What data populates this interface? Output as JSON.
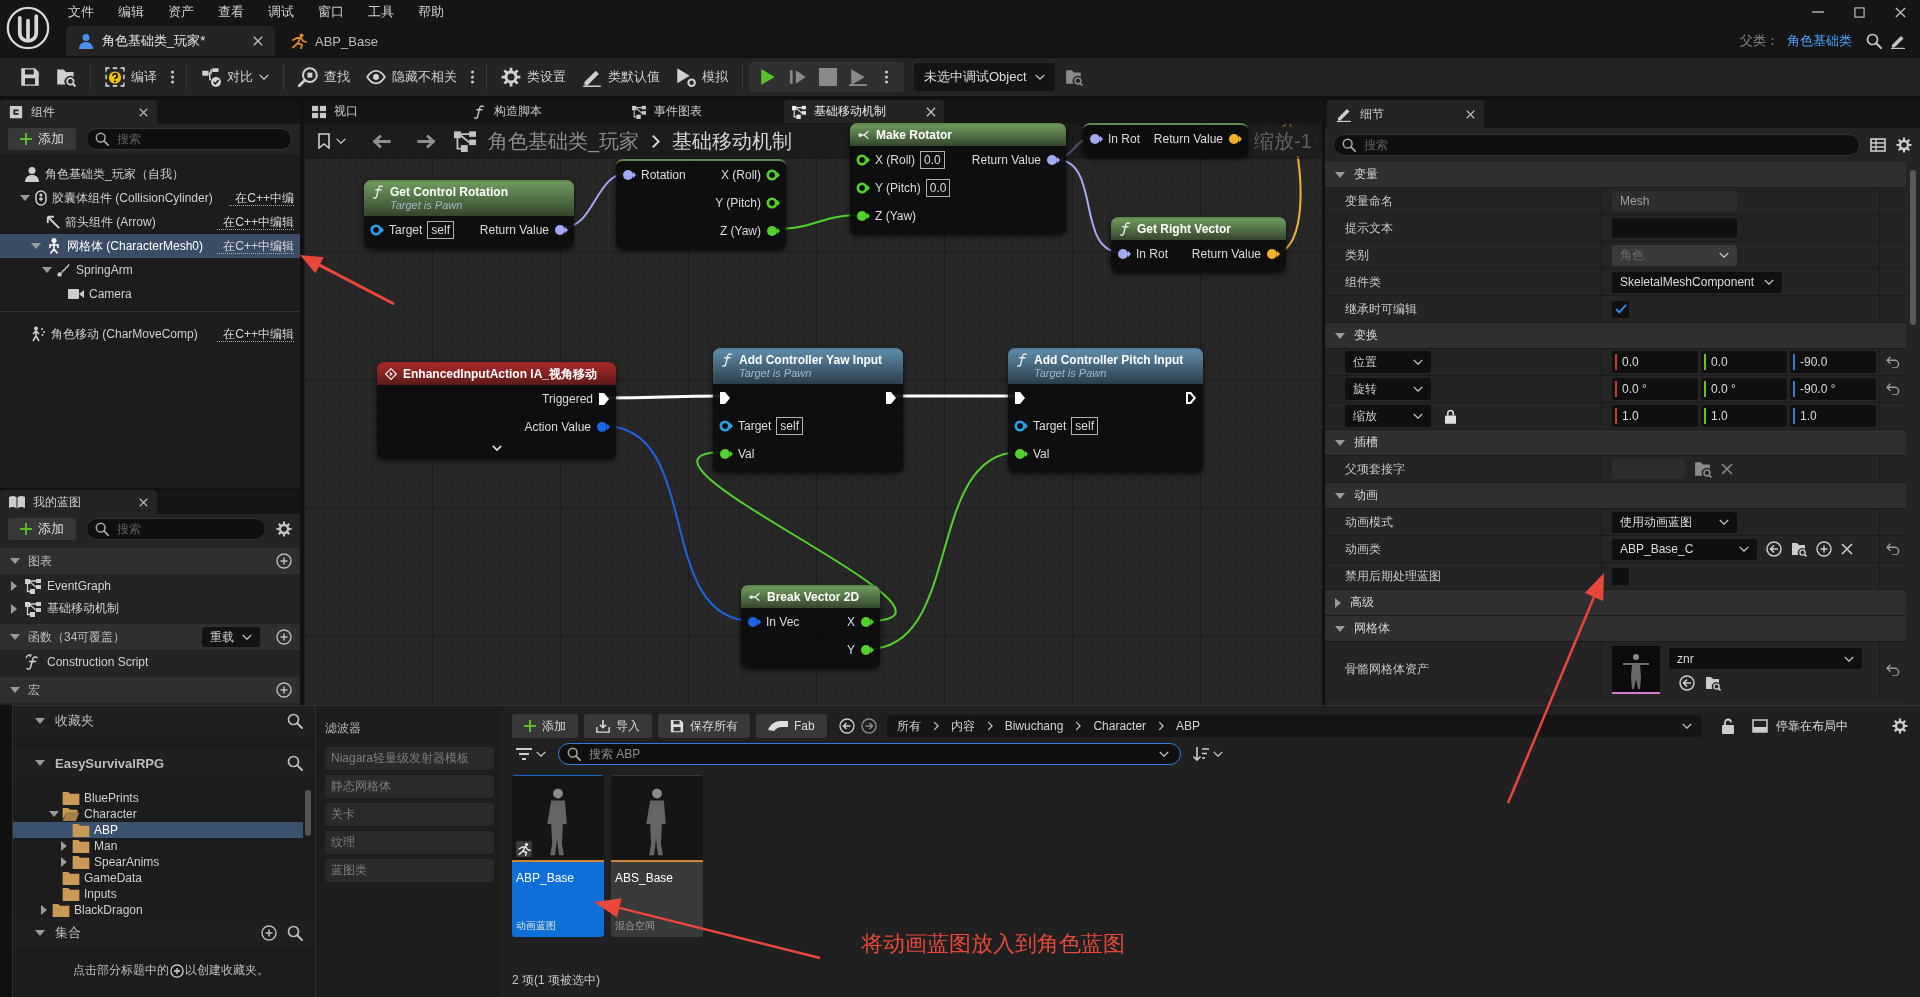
{
  "menu_bar": {
    "items": [
      "文件",
      "编辑",
      "资产",
      "查看",
      "调试",
      "窗口",
      "工具",
      "帮助"
    ]
  },
  "document_tabs": [
    {
      "label": "角色基础类_玩家*",
      "kind": "blueprint",
      "selected": true
    },
    {
      "label": "ABP_Base",
      "kind": "anim_blueprint",
      "selected": false
    }
  ],
  "parent_class": {
    "label": "父类：",
    "value": "角色基础类"
  },
  "toolbar": {
    "groups": [
      [
        {
          "kind": "save"
        },
        {
          "kind": "browse"
        }
      ],
      [
        {
          "kind": "compile",
          "label": "编译",
          "more": true
        }
      ],
      [
        {
          "kind": "diff",
          "label": "对比",
          "caret": true
        }
      ],
      [
        {
          "kind": "find",
          "label": "查找"
        },
        {
          "kind": "hide",
          "label": "隐藏不相关",
          "more": true
        }
      ],
      [
        {
          "kind": "class_settings",
          "label": "类设置"
        },
        {
          "kind": "class_defaults",
          "label": "类默认值"
        },
        {
          "kind": "simulate",
          "label": "模拟"
        }
      ]
    ],
    "play_controls": [
      {
        "kind": "play"
      },
      {
        "kind": "advance"
      },
      {
        "kind": "stop"
      },
      {
        "kind": "eject"
      }
    ],
    "play_more": true,
    "debug_object": "未选中调试Object"
  },
  "components": {
    "title": "组件",
    "add_label": "添加",
    "search_placeholder": "搜索",
    "tree": [
      {
        "label": "角色基础类_玩家（自我）",
        "kind": "actor",
        "selected": false,
        "children": [
          {
            "label": "胶囊体组件 (CollisionCylinder)",
            "kind": "capsule",
            "edit_link": "在C++中编",
            "selected": false,
            "expanded": true,
            "children": [
              {
                "label": "箭头组件 (Arrow)",
                "kind": "arrow",
                "edit_link": "在C++中编辑",
                "selected": false
              },
              {
                "label": "网格体 (CharacterMesh0)",
                "kind": "mesh",
                "edit_link": "在C++中编辑",
                "selected": true,
                "expanded": true,
                "children": [
                  {
                    "label": "SpringArm",
                    "kind": "spring_arm",
                    "selected": false,
                    "expanded": true,
                    "children": [
                      {
                        "label": "Camera",
                        "kind": "camera",
                        "selected": false
                      }
                    ]
                  }
                ]
              }
            ]
          }
        ]
      }
    ],
    "other": [
      {
        "label": "角色移动 (CharMoveComp)",
        "kind": "movement",
        "edit_link": "在C++中编辑",
        "selected": false
      }
    ]
  },
  "my_blueprint": {
    "title": "我的蓝图",
    "add_label": "添加",
    "search_placeholder": "搜索",
    "sections": [
      {
        "title": "图表",
        "expanded": true,
        "items": [
          {
            "label": "EventGraph",
            "kind": "graph",
            "expanded": false
          },
          {
            "label": "基础移动机制",
            "kind": "graph",
            "expanded": false
          }
        ]
      },
      {
        "title": "函数（34可覆盖）",
        "expanded": true,
        "override_label": "重载",
        "items": [
          {
            "label": "Construction Script",
            "kind": "construction"
          }
        ]
      },
      {
        "title": "宏",
        "expanded": true
      }
    ]
  },
  "graph_tabs": [
    {
      "label": "视口",
      "kind": "viewport",
      "selected": false
    },
    {
      "label": "构造脚本",
      "kind": "function",
      "selected": false
    },
    {
      "label": "事件图表",
      "kind": "graph",
      "selected": false
    },
    {
      "label": "基础移动机制",
      "kind": "graph",
      "selected": true
    }
  ],
  "breadcrumb": [
    "角色基础类_玩家",
    "基础移动机制"
  ],
  "zoom_label": "缩放-1",
  "nodes": [
    {
      "kind": "pure_function",
      "title": "Get Control Rotation",
      "subtitle": "Target is Pawn",
      "rows": [
        {
          "in": {
            "label": "Target",
            "kind": "data",
            "color": "#2aa0e8",
            "connected": false,
            "default": "self"
          },
          "out": {
            "label": "Return Value",
            "kind": "data",
            "color": "#a3aaf5",
            "connected": true
          }
        }
      ]
    },
    {
      "kind": "struct",
      "rows": [
        {
          "in": {
            "label": "Rotation",
            "kind": "data",
            "color": "#a3aaf5",
            "connected": true
          },
          "out": {
            "label": "X (Roll)",
            "kind": "data",
            "color": "#52d22a",
            "connected": false
          }
        },
        {
          "out": {
            "label": "Y (Pitch)",
            "kind": "data",
            "color": "#52d22a",
            "connected": false
          }
        },
        {
          "out": {
            "label": "Z (Yaw)",
            "kind": "data",
            "color": "#52d22a",
            "connected": true
          }
        }
      ]
    },
    {
      "kind": "struct",
      "title": "Make Rotator",
      "rows": [
        {
          "in": {
            "label": "X (Roll)",
            "kind": "data",
            "color": "#52d22a",
            "connected": false,
            "default": "0.0"
          },
          "out": {
            "label": "Return Value",
            "kind": "data",
            "color": "#a3aaf5",
            "connected": true
          }
        },
        {
          "in": {
            "label": "Y (Pitch)",
            "kind": "data",
            "color": "#52d22a",
            "connected": false,
            "default": "0.0"
          }
        },
        {
          "in": {
            "label": "Z (Yaw)",
            "kind": "data",
            "color": "#52d22a",
            "connected": true
          }
        }
      ]
    },
    {
      "kind": "pure_function",
      "rows": [
        {
          "in": {
            "label": "In Rot",
            "kind": "data",
            "color": "#a3aaf5",
            "connected": true
          },
          "out": {
            "label": "Return Value",
            "kind": "data",
            "color": "#f3b12e",
            "connected": true
          }
        }
      ]
    },
    {
      "kind": "pure_function",
      "title": "Get Right Vector",
      "rows": [
        {
          "in": {
            "label": "In Rot",
            "kind": "data",
            "color": "#a3aaf5",
            "connected": true
          },
          "out": {
            "label": "Return Value",
            "kind": "data",
            "color": "#f3b12e",
            "connected": true
          }
        }
      ]
    },
    {
      "kind": "event",
      "title": "EnhancedInputAction IA_视角移动",
      "advanced_pins": true,
      "rows": [
        {
          "out": {
            "label": "Triggered",
            "kind": "exec",
            "color": "#ffffff",
            "connected": true
          }
        },
        {
          "out": {
            "label": "Action Value",
            "kind": "data",
            "color": "#1a66e6",
            "connected": true
          }
        }
      ]
    },
    {
      "kind": "function",
      "title": "Add Controller Yaw Input",
      "subtitle": "Target is Pawn",
      "rows": [
        {
          "in": {
            "kind": "exec",
            "color": "#ffffff",
            "connected": true
          },
          "out": {
            "kind": "exec",
            "color": "#ffffff",
            "connected": true
          }
        },
        {
          "in": {
            "label": "Target",
            "kind": "data",
            "color": "#2aa0e8",
            "connected": false,
            "default": "self"
          }
        },
        {
          "in": {
            "label": "Val",
            "kind": "data",
            "color": "#52d22a",
            "connected": true
          }
        }
      ]
    },
    {
      "kind": "function",
      "title": "Add Controller Pitch Input",
      "subtitle": "Target is Pawn",
      "rows": [
        {
          "in": {
            "kind": "exec",
            "color": "#ffffff",
            "connected": true
          },
          "out": {
            "kind": "exec",
            "color": "#ffffff",
            "connected": false
          }
        },
        {
          "in": {
            "label": "Target",
            "kind": "data",
            "color": "#2aa0e8",
            "connected": false,
            "default": "self"
          }
        },
        {
          "in": {
            "label": "Val",
            "kind": "data",
            "color": "#52d22a",
            "connected": true
          }
        }
      ]
    },
    {
      "kind": "struct",
      "title": "Break Vector 2D",
      "rows": [
        {
          "in": {
            "label": "In Vec",
            "kind": "data",
            "color": "#1a66e6",
            "connected": true
          },
          "out": {
            "label": "X",
            "kind": "data",
            "color": "#52d22a",
            "connected": true
          }
        },
        {
          "out": {
            "label": "Y",
            "kind": "data",
            "color": "#52d22a",
            "connected": true
          }
        }
      ]
    }
  ],
  "details": {
    "title": "细节",
    "search_placeholder": "搜索",
    "sections": [
      {
        "title": "变量",
        "expanded": true,
        "rows": [
          {
            "label": "变量命名",
            "kind": "text",
            "value": "Mesh",
            "disabled": true
          },
          {
            "label": "提示文本",
            "kind": "text",
            "disabled": false
          },
          {
            "label": "类别",
            "kind": "dropdown",
            "value": "角色",
            "disabled": true
          },
          {
            "label": "组件类",
            "kind": "dropdown",
            "value": "SkeletalMeshComponent",
            "disabled": false
          },
          {
            "label": "继承时可编辑",
            "kind": "checkbox",
            "checked": true
          }
        ]
      },
      {
        "title": "变换",
        "expanded": true,
        "rows": [
          {
            "label": "位置",
            "kind": "vector",
            "values": [
              "0.0",
              "0.0",
              "-90.0"
            ],
            "resettable": true
          },
          {
            "label": "旋转",
            "kind": "vector",
            "values": [
              "0.0 °",
              "0.0 °",
              "-90.0 °"
            ],
            "resettable": true
          },
          {
            "label": "缩放",
            "kind": "vector",
            "values": [
              "1.0",
              "1.0",
              "1.0"
            ],
            "locked": true
          }
        ]
      },
      {
        "title": "插槽",
        "expanded": true,
        "rows": [
          {
            "label": "父项套接字",
            "kind": "socket_picker"
          }
        ]
      },
      {
        "title": "动画",
        "expanded": true,
        "rows": [
          {
            "label": "动画模式",
            "kind": "dropdown",
            "value": "使用动画蓝图",
            "disabled": false
          },
          {
            "label": "动画类",
            "kind": "class_picker",
            "value": "ABP_Base_C",
            "resettable": true
          },
          {
            "label": "禁用后期处理蓝图",
            "kind": "checkbox",
            "checked": false
          }
        ]
      },
      {
        "title": "高级",
        "expanded": false
      },
      {
        "title": "网格体",
        "expanded": true,
        "rows": [
          {
            "label": "骨骼网格体资产",
            "kind": "mesh_asset",
            "value": "znr",
            "resettable": true
          }
        ]
      }
    ]
  },
  "content_browser": {
    "favorites": {
      "title": "收藏夹",
      "expanded": true
    },
    "project": {
      "title": "EasySurvivalRPG",
      "expanded": true,
      "folders": [
        {
          "children": [
            {
              "label": "BluePrints",
              "selected": false
            },
            {
              "label": "Character",
              "selected": false,
              "expanded": true,
              "children": [
                {
                  "label": "ABP",
                  "selected": true
                },
                {
                  "label": "Man",
                  "selected": false,
                  "expanded": false
                },
                {
                  "label": "SpearAnims",
                  "selected": false,
                  "expanded": false
                }
              ]
            },
            {
              "label": "GameData",
              "selected": false
            },
            {
              "label": "Inputs",
              "selected": false
            }
          ]
        },
        {
          "label": "BlackDragon",
          "selected": false,
          "expanded": false
        }
      ]
    },
    "collections": {
      "title": "集合",
      "expanded": true,
      "hint_before": "点击部分标题中的",
      "hint_after": "以创建收藏夹。"
    },
    "filters": {
      "title": "滤波器",
      "items": [
        "Niagara轻量级发射器模板",
        "静态网格体",
        "关卡",
        "纹理",
        "蓝图类"
      ]
    },
    "toolbar": [
      {
        "kind": "add",
        "label": "添加"
      },
      {
        "kind": "import",
        "label": "导入"
      },
      {
        "kind": "save_all",
        "label": "保存所有"
      },
      {
        "kind": "fab",
        "label": "Fab"
      }
    ],
    "path": [
      "所有",
      "内容",
      "Biwuchang",
      "Character",
      "ABP"
    ],
    "dock_label": "停靠在布局中",
    "search_placeholder": "搜索 ABP",
    "assets": [
      {
        "name": "ABP_Base",
        "type": "动画蓝图",
        "kind": "anim_blueprint",
        "selected": true
      },
      {
        "name": "ABS_Base",
        "type": "混合空间",
        "kind": "blend_space",
        "selected": false
      }
    ],
    "status": "2 项(1 项被选中)"
  },
  "annotation": {
    "text": "将动画蓝图放入到角色蓝图"
  }
}
